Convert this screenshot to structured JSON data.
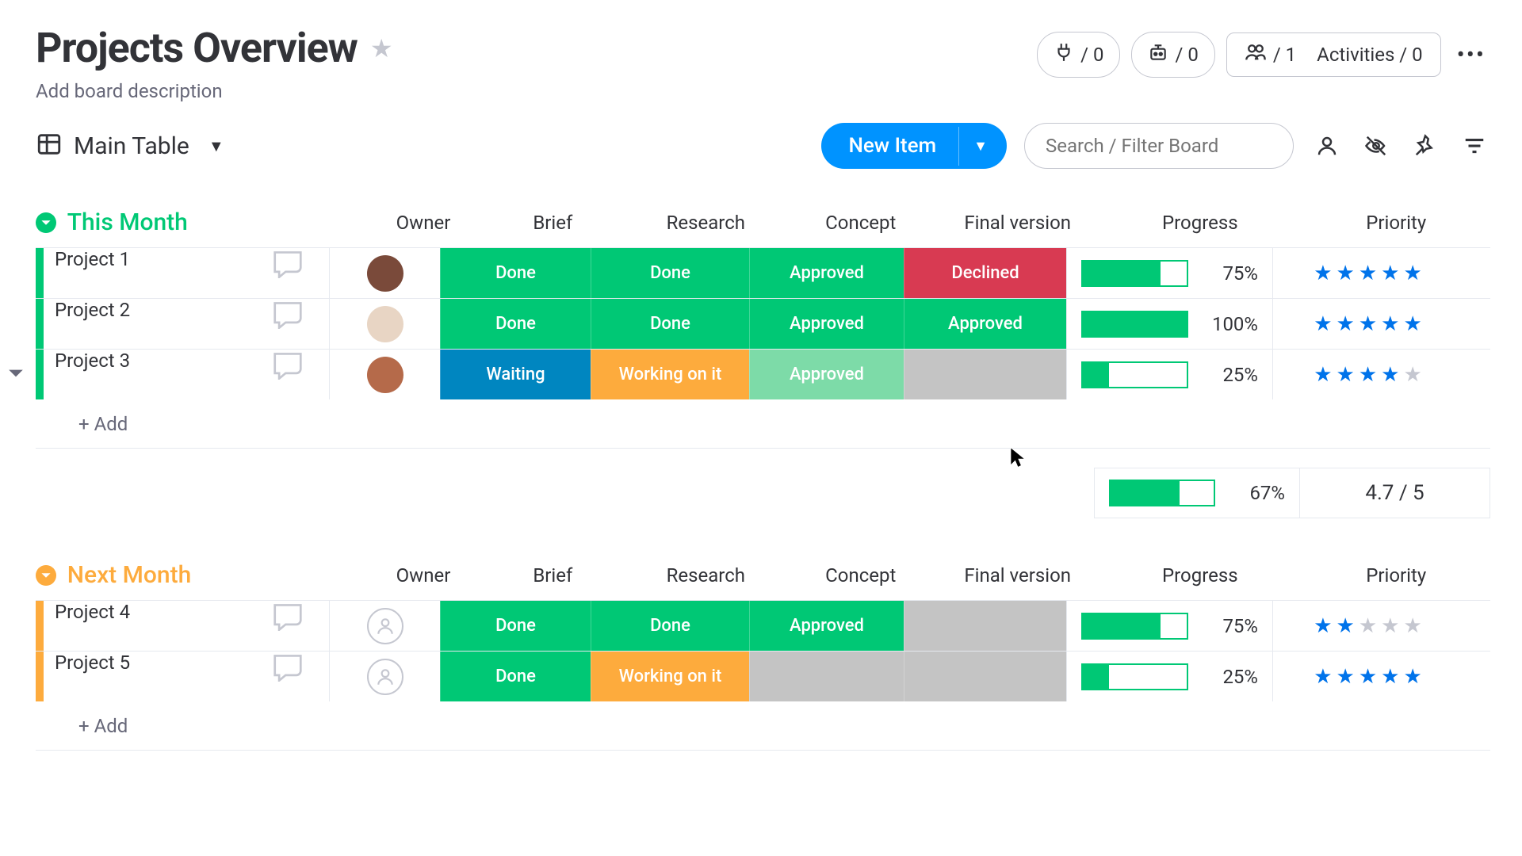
{
  "header": {
    "title": "Projects Overview",
    "description_placeholder": "Add board description",
    "automations_count": "/ 0",
    "integrations_count": "/ 0",
    "members_count": "/ 1",
    "activities_label": "Activities / 0"
  },
  "viewbar": {
    "view_name": "Main Table",
    "new_item_label": "New Item",
    "search_placeholder": "Search / Filter Board"
  },
  "columns": {
    "owner": "Owner",
    "brief": "Brief",
    "research": "Research",
    "concept": "Concept",
    "final": "Final version",
    "progress": "Progress",
    "priority": "Priority"
  },
  "status_labels": {
    "done": "Done",
    "approved": "Approved",
    "declined": "Declined",
    "waiting": "Waiting",
    "working": "Working on it",
    "empty": ""
  },
  "groups": [
    {
      "title": "This Month",
      "color": "green",
      "rows": [
        {
          "name": "Project 1",
          "avatar": "#7a4a3a",
          "brief": "done",
          "research": "done",
          "concept": "approved",
          "final": "declined",
          "progress": 75,
          "progress_text": "75%",
          "stars": 5
        },
        {
          "name": "Project 2",
          "avatar": "#e8d5c4",
          "brief": "done",
          "research": "done",
          "concept": "approved",
          "final": "approved",
          "progress": 100,
          "progress_text": "100%",
          "stars": 5
        },
        {
          "name": "Project 3",
          "avatar": "#b56a4a",
          "brief": "waiting",
          "research": "working",
          "concept": "approved-muted",
          "final": "empty",
          "progress": 25,
          "progress_text": "25%",
          "stars": 4,
          "caret": true
        }
      ],
      "add_label": "+ Add",
      "summary": {
        "progress": 67,
        "progress_text": "67%",
        "rating_text": "4.7  / 5"
      }
    },
    {
      "title": "Next Month",
      "color": "yellow",
      "rows": [
        {
          "name": "Project 4",
          "avatar": null,
          "brief": "done",
          "research": "done",
          "concept": "approved",
          "final": "empty",
          "progress": 75,
          "progress_text": "75%",
          "stars": 2
        },
        {
          "name": "Project 5",
          "avatar": null,
          "brief": "done",
          "research": "working",
          "concept": "empty",
          "final": "empty",
          "progress": 25,
          "progress_text": "25%",
          "stars": 5
        }
      ],
      "add_label": "+ Add"
    }
  ]
}
